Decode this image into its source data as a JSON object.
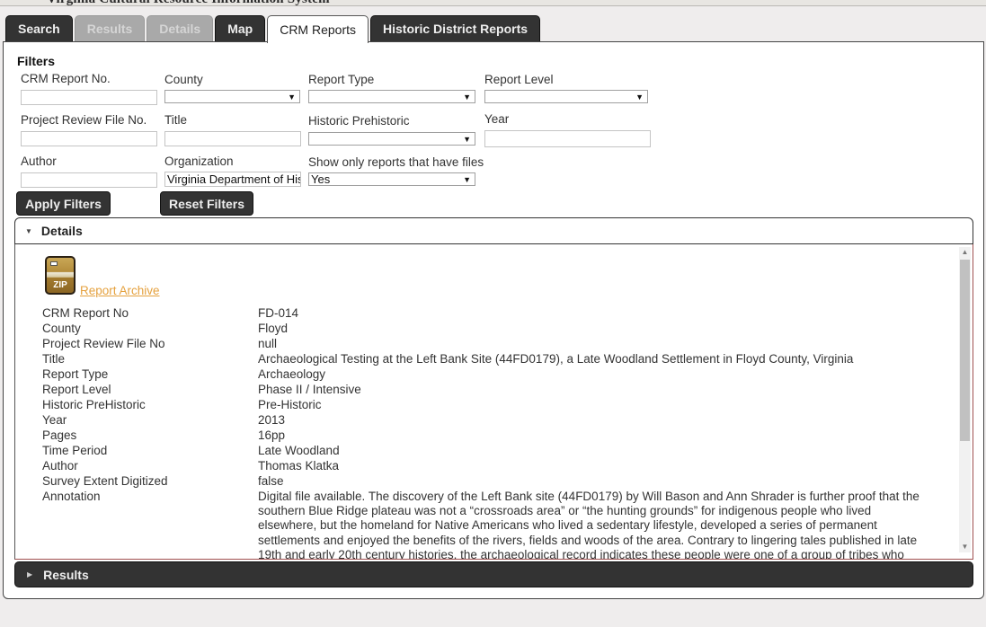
{
  "app": {
    "banner_title": "Virginia Cultural Resource Information System"
  },
  "tabs": [
    {
      "label": "Search",
      "state": "enabled"
    },
    {
      "label": "Results",
      "state": "disabled"
    },
    {
      "label": "Details",
      "state": "disabled"
    },
    {
      "label": "Map",
      "state": "enabled"
    },
    {
      "label": "CRM Reports",
      "state": "active"
    },
    {
      "label": "Historic District Reports",
      "state": "enabled"
    }
  ],
  "filters": {
    "title": "Filters",
    "crm_report_no": {
      "label": "CRM Report No.",
      "value": ""
    },
    "county": {
      "label": "County",
      "value": ""
    },
    "report_type": {
      "label": "Report Type",
      "value": ""
    },
    "report_level": {
      "label": "Report Level",
      "value": ""
    },
    "project_review_file_no": {
      "label": "Project Review File No.",
      "value": ""
    },
    "title_field": {
      "label": "Title",
      "value": ""
    },
    "historic_prehistoric": {
      "label": "Historic Prehistoric",
      "value": ""
    },
    "year": {
      "label": "Year",
      "value": ""
    },
    "author": {
      "label": "Author",
      "value": ""
    },
    "organization": {
      "label": "Organization",
      "value": "Virginia Department of Hist"
    },
    "show_only_files": {
      "label": "Show only reports that have files",
      "value": "Yes"
    },
    "apply_label": "Apply Filters",
    "reset_label": "Reset Filters"
  },
  "details": {
    "header": "Details",
    "archive_icon": "zip-file-icon",
    "archive_icon_text": "ZIP",
    "archive_link": "Report Archive",
    "rows": [
      {
        "key": "CRM Report No",
        "value": "FD-014"
      },
      {
        "key": "County",
        "value": "Floyd"
      },
      {
        "key": "Project Review File No",
        "value": "null"
      },
      {
        "key": "Title",
        "value": "Archaeological Testing at the Left Bank Site (44FD0179), a Late Woodland Settlement in Floyd County, Virginia"
      },
      {
        "key": "Report Type",
        "value": "Archaeology"
      },
      {
        "key": "Report Level",
        "value": "Phase II / Intensive"
      },
      {
        "key": "Historic PreHistoric",
        "value": "Pre-Historic"
      },
      {
        "key": "Year",
        "value": "2013"
      },
      {
        "key": "Pages",
        "value": "16pp"
      },
      {
        "key": "Time Period",
        "value": "Late Woodland"
      },
      {
        "key": "Author",
        "value": "Thomas Klatka"
      },
      {
        "key": "Survey Extent Digitized",
        "value": "false"
      }
    ],
    "annotation_key": "Annotation",
    "annotation_value": "Digital file available. The discovery of the Left Bank site (44FD0179) by Will Bason and Ann Shrader is further proof that the southern Blue Ridge plateau was not a “crossroads area” or “the hunting grounds” for indigenous people who lived elsewhere, but the homeland for Native Americans who lived a sedentary lifestyle, developed a series of permanent settlements and enjoyed the benefits of the rivers, fields and woods of the area. Contrary to lingering tales published in late 19th and early 20th century histories, the archaeological record indicates these people were one of a group of tribes who spoke Eastern Siouan languages and were closely"
  },
  "results": {
    "header": "Results"
  },
  "icons": {
    "caret_down": "▼",
    "caret_right": "▶",
    "select_arrow": "▼",
    "scroll_up": "▲",
    "scroll_down": "▼"
  }
}
